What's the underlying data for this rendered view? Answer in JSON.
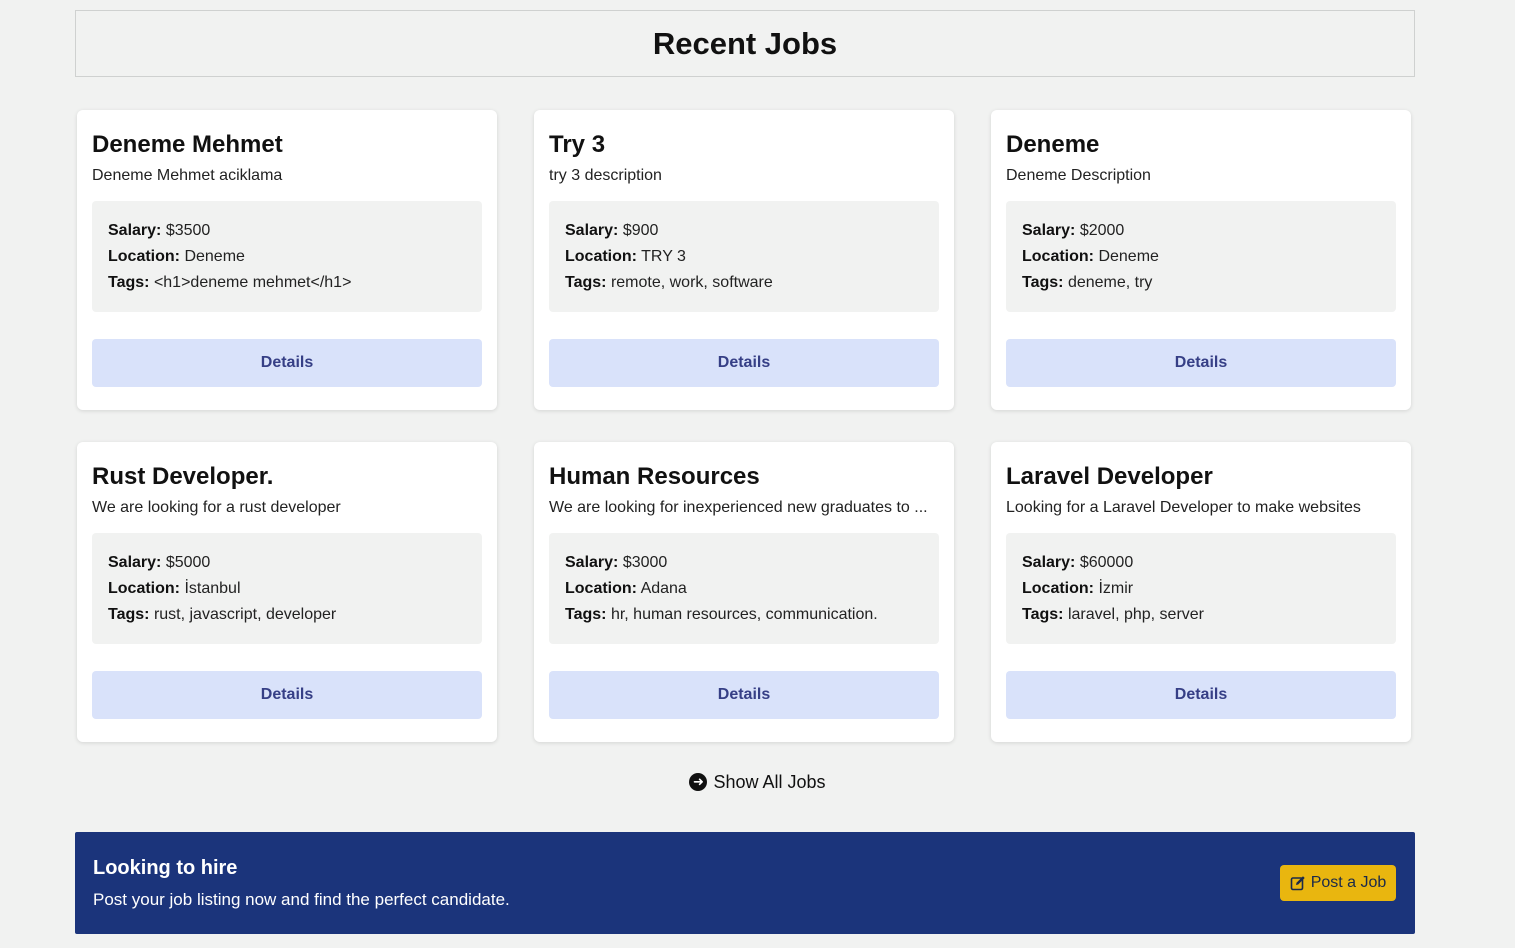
{
  "header": {
    "title": "Recent Jobs"
  },
  "labels": {
    "salary": "Salary:",
    "location": "Location:",
    "tags": "Tags:",
    "details": "Details"
  },
  "jobs": [
    {
      "title": "Deneme Mehmet",
      "description": "Deneme Mehmet aciklama",
      "salary": "$3500",
      "location": "Deneme",
      "tags": "<h1>deneme mehmet</h1>"
    },
    {
      "title": "Try 3",
      "description": "try 3 description",
      "salary": "$900",
      "location": "TRY 3",
      "tags": "remote, work, software"
    },
    {
      "title": "Deneme",
      "description": "Deneme Description",
      "salary": "$2000",
      "location": "Deneme",
      "tags": "deneme, try"
    },
    {
      "title": "Rust Developer.",
      "description": "We are looking for a rust developer",
      "salary": "$5000",
      "location": "İstanbul",
      "tags": "rust, javascript, developer"
    },
    {
      "title": "Human Resources",
      "description": "We are looking for inexperienced new graduates to ...",
      "salary": "$3000",
      "location": "Adana",
      "tags": "hr, human resources, communication."
    },
    {
      "title": "Laravel Developer",
      "description": "Looking for a Laravel Developer to make websites",
      "salary": "$60000",
      "location": "İzmir",
      "tags": "laravel, php, server"
    }
  ],
  "show_all": {
    "label": "Show All Jobs",
    "icon": "arrow-circle-right-icon"
  },
  "hire_banner": {
    "title": "Looking to hire",
    "text": "Post your job listing now and find the perfect candidate.",
    "button_label": "Post a Job",
    "button_icon": "edit-icon",
    "background": "#1b347b",
    "button_color": "#e9b60f"
  }
}
